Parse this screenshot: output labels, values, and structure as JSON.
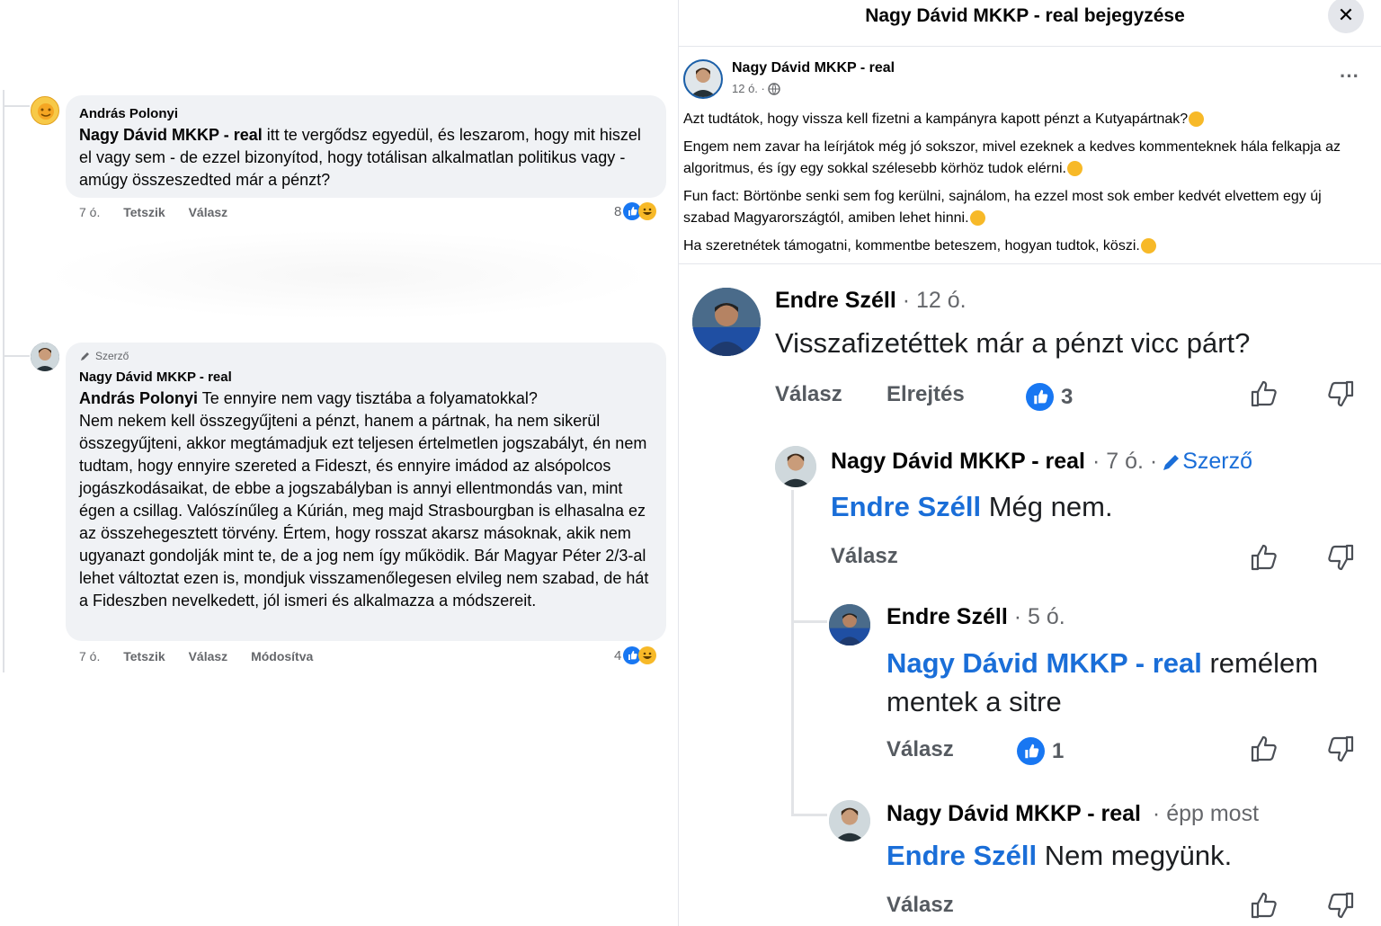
{
  "left": {
    "c1": {
      "author": "András Polonyi",
      "mention": "Nagy Dávid MKKP - real",
      "text": " itt te vergődsz egyedül, és leszarom, hogy mit hiszel el vagy sem - de ezzel bizonyítod, hogy totálisan alkalmatlan politikus vagy - amúgy összeszedted már a pénzt?",
      "time": "7 ó.",
      "like": "Tetszik",
      "reply": "Válasz",
      "count": "8"
    },
    "c2": {
      "badge": "Szerző",
      "author": "Nagy Dávid MKKP - real",
      "mention": "András Polonyi",
      "first_line": " Te ennyire nem vagy tisztába a folyamatokkal?",
      "text": "Nem nekem kell összegyűjteni a pénzt, hanem a pártnak, ha nem sikerül összegyűjteni, akkor megtámadjuk ezt teljesen értelmetlen jogszabályt, én nem tudtam, hogy ennyire szereted a Fideszt, és ennyire imádod az alsópolcos jogászkodásaikat, de ebbe a jogszabályban is annyi ellentmondás van, mint égen a csillag. Valószínűleg a Kúrián, meg majd Strasbourgban is elhasalna ez az összehegesztett törvény. Értem, hogy rosszat akarsz másoknak, akik nem ugyanazt gondolják mint te, de a jog nem így működik. Bár Magyar Péter 2/3-al lehet változtat ezen is, mondjuk visszamenőlegesen elvileg nem szabad, de hát a Fideszben nevelkedett, jól ismeri és alkalmazza a módszereit.",
      "time": "7 ó.",
      "like": "Tetszik",
      "reply": "Válasz",
      "edited": "Módosítva",
      "count": "4"
    }
  },
  "right": {
    "header": {
      "title": "Nagy Dávid MKKP - real bejegyzése",
      "close": "✕"
    },
    "post": {
      "author": "Nagy Dávid MKKP - real",
      "time": "12 ó. ·",
      "more": "···",
      "p1": "Azt tudtátok, hogy vissza kell fizetni a kampányra kapott pénzt a Kutyapártnak?",
      "p2": "Engem nem zavar ha leírjátok még jó sokszor, mivel ezeknek a kedves kommenteknek hála felkapja az algoritmus, és így egy sokkal szélesebb körhöz tudok elérni.",
      "p3": "Fun fact: Börtönbe senki sem fog kerülni, sajnálom, ha ezzel most sok ember kedvét elvettem egy új szabad Magyarországtól, amiben lehet hinni.",
      "p4": "Ha szeretnétek támogatni, kommentbe beteszem, hogyan tudtok, köszi."
    },
    "m1": {
      "author": "Endre Széll",
      "time": "· 12 ó.",
      "text": "Visszafizetéttek már a pénzt vicc párt?",
      "reply": "Válasz",
      "hide": "Elrejtés",
      "likes": "3"
    },
    "m2": {
      "author": "Nagy Dávid MKKP - real",
      "time": "· 7 ó. ·",
      "badge": "Szerző",
      "mention": "Endre Széll",
      "text": " Még nem.",
      "reply": "Válasz"
    },
    "m3": {
      "author": "Endre Széll",
      "time": "· 5 ó.",
      "mention": "Nagy Dávid MKKP - real",
      "text": " remélem mentek a sitre",
      "reply": "Válasz",
      "likes": "1"
    },
    "m4": {
      "author": "Nagy Dávid MKKP - real",
      "time": "· épp most",
      "mention": "Endre Széll",
      "text": " Nem megyünk.",
      "reply": "Válasz"
    }
  }
}
